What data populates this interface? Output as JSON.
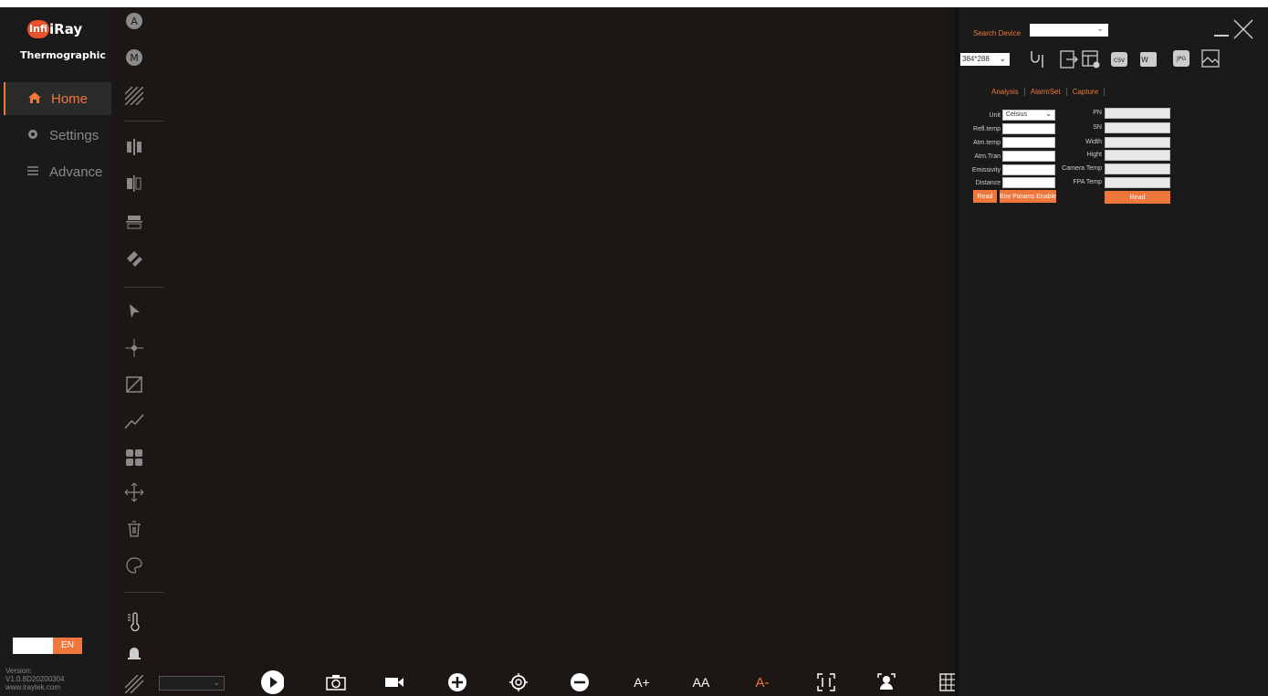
{
  "brand": {
    "badge": "Infi",
    "name": "iRay",
    "subtitle": "Thermographic"
  },
  "nav": [
    {
      "label": "Home",
      "icon": "home-icon"
    },
    {
      "label": "Settings",
      "icon": "gear-icon"
    },
    {
      "label": "Advance",
      "icon": "sliders-icon"
    }
  ],
  "language": {
    "label": "EN"
  },
  "version": {
    "line1": "Version:",
    "line2": "V1.0.8D20200304",
    "line3": "www.iraytek.com"
  },
  "right_panel": {
    "search_label": "Search Device",
    "resolution": "384*288",
    "tabs": [
      "Analysis",
      "AlarmSet",
      "Capture"
    ],
    "left_fields": [
      {
        "label": "Unit",
        "value": "Celsius"
      },
      {
        "label": "Refl.temp",
        "value": ""
      },
      {
        "label": "Atm.temp",
        "value": ""
      },
      {
        "label": "Atm.Tran",
        "value": ""
      },
      {
        "label": "Emissivity",
        "value": ""
      },
      {
        "label": "Distance",
        "value": ""
      }
    ],
    "right_fields": [
      {
        "label": "PN",
        "value": ""
      },
      {
        "label": "SN",
        "value": ""
      },
      {
        "label": "Width",
        "value": ""
      },
      {
        "label": "Hight",
        "value": ""
      },
      {
        "label": "Camera Temp",
        "value": ""
      },
      {
        "label": "FPA Temp",
        "value": ""
      }
    ],
    "read_left": "Read",
    "env_button": "Env Params Enable",
    "read_right": "Read",
    "export_icons": [
      "csv",
      "word",
      "jpg"
    ]
  },
  "bottom": {
    "zoom_in": "A+",
    "zoom_fit": "AA",
    "zoom_out": "A-"
  },
  "colors": {
    "accent": "#f0773b",
    "bg": "#1c1714",
    "panel": "#1a1a1a"
  }
}
